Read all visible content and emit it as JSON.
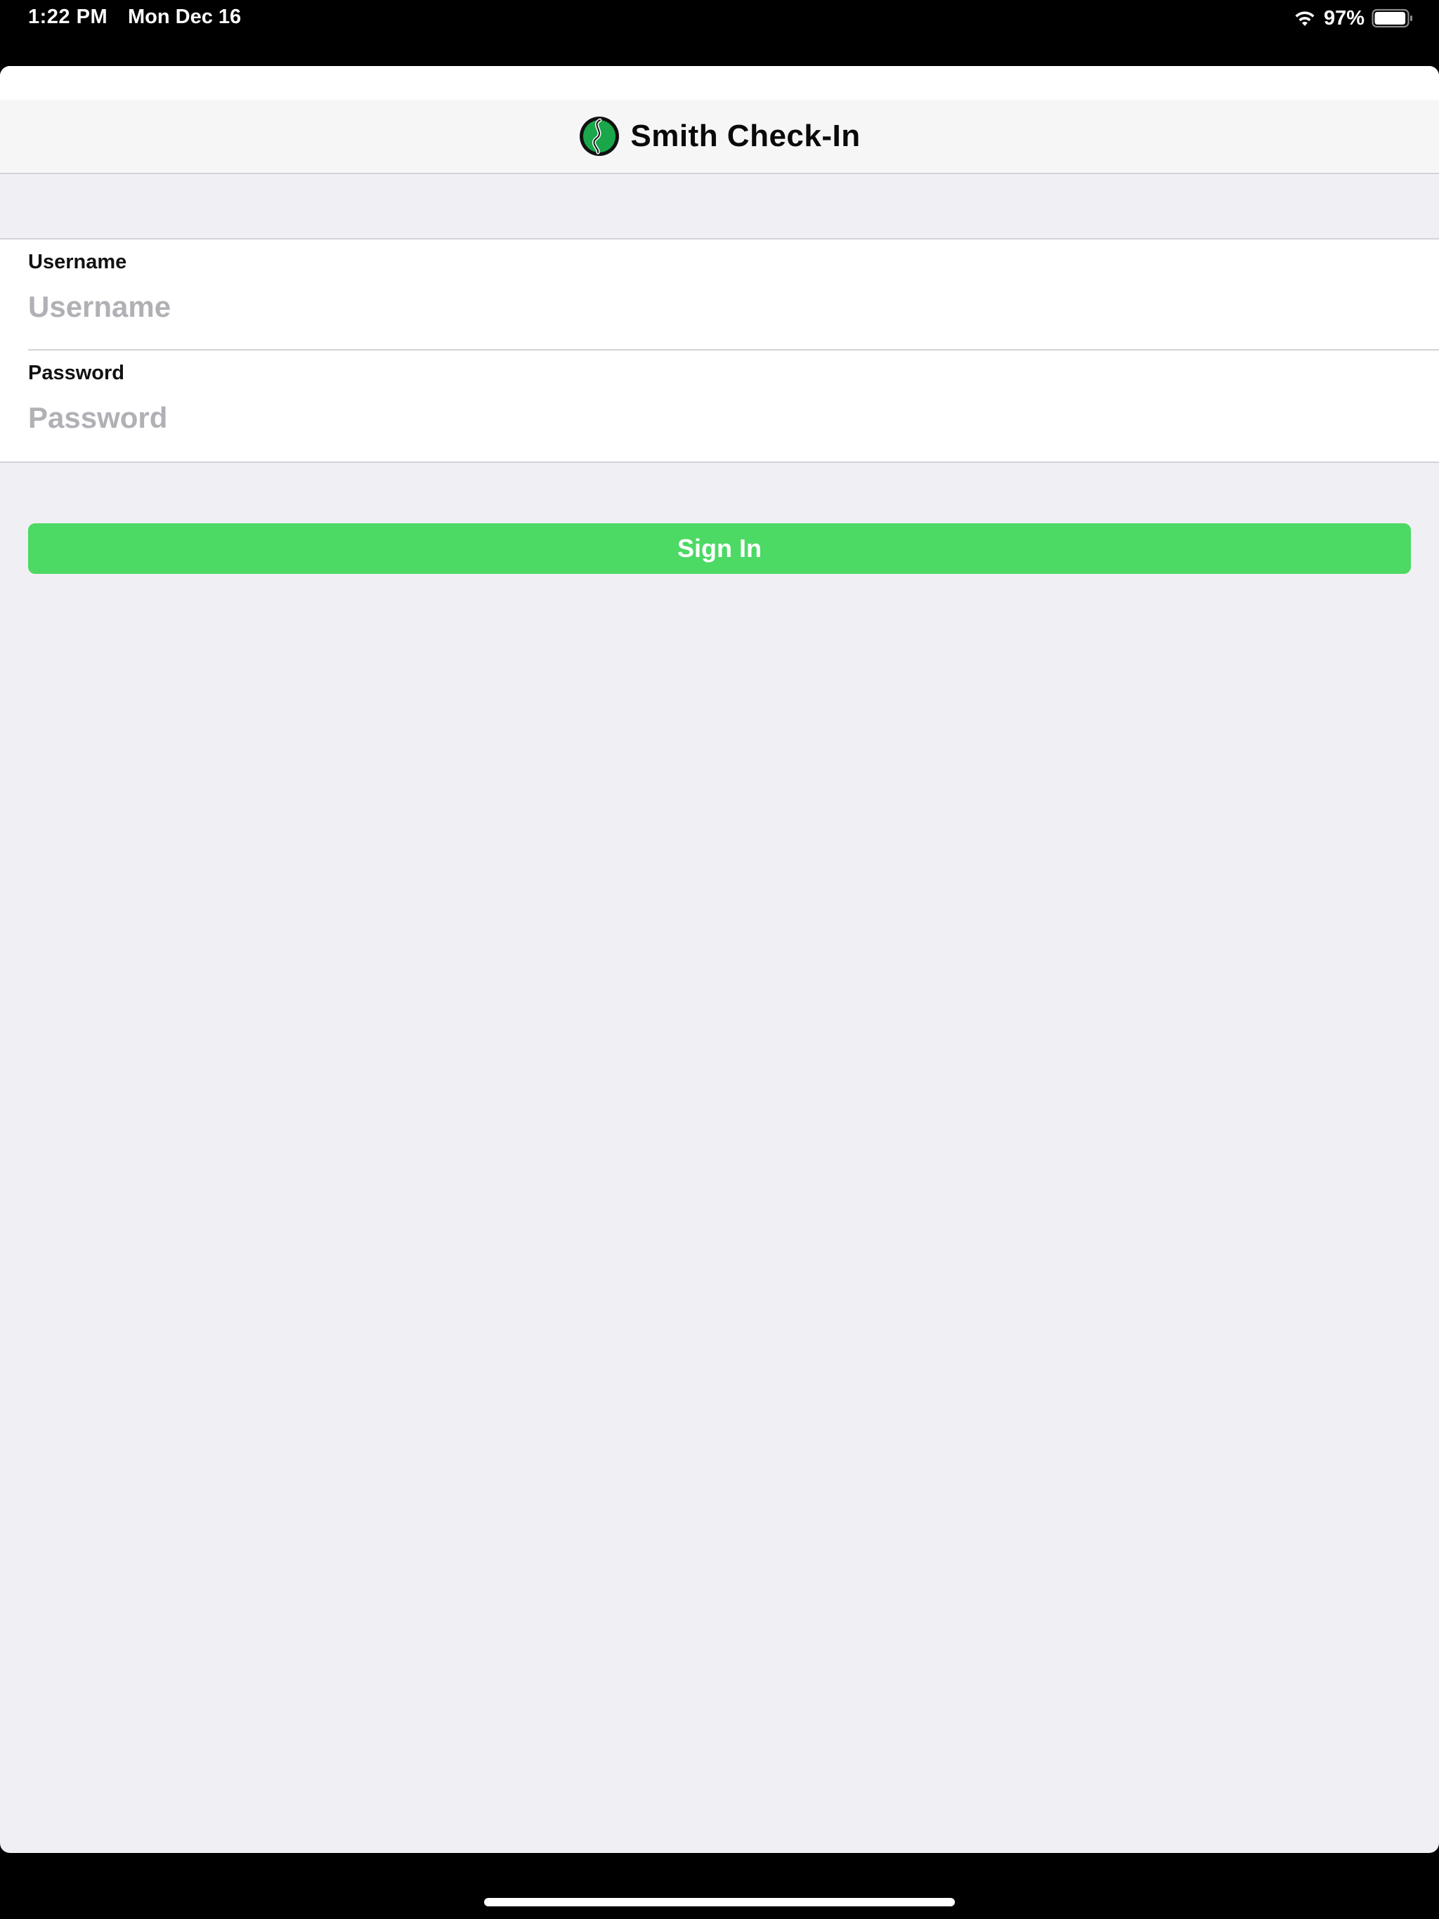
{
  "status_bar": {
    "time": "1:22 PM",
    "date": "Mon Dec 16",
    "battery_percent": "97%",
    "battery_level": 0.97,
    "wifi_icon": "wifi-icon",
    "battery_icon": "battery-icon"
  },
  "header": {
    "title": "Smith Check-In",
    "logo_icon": "smith-logo-icon"
  },
  "form": {
    "username": {
      "label": "Username",
      "value": "",
      "placeholder": "Username"
    },
    "password": {
      "label": "Password",
      "value": "",
      "placeholder": "Password"
    }
  },
  "actions": {
    "sign_in_label": "Sign In"
  },
  "colors": {
    "accent_green": "#4cd964",
    "background": "#efeff4",
    "nav_background": "#f6f6f7",
    "placeholder": "#b0b0b5"
  }
}
